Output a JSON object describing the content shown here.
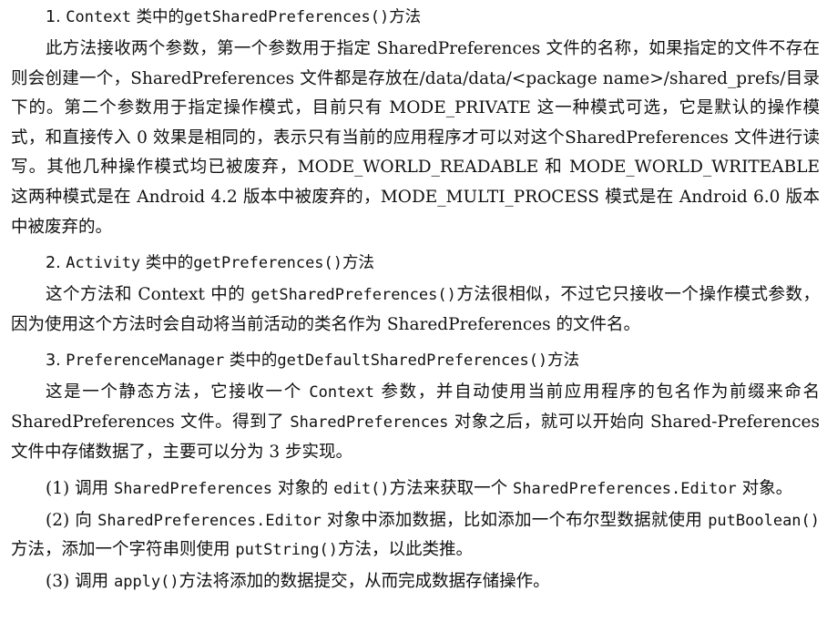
{
  "sections": [
    {
      "number": "1.",
      "heading_code": "Context",
      "heading_mid": "类中的",
      "heading_code2": "getSharedPreferences()",
      "heading_tail": "方法",
      "body": "此方法接收两个参数，第一个参数用于指定 SharedPreferences 文件的名称，如果指定的文件不存在则会创建一个，SharedPreferences 文件都是存放在/data/data/<package name>/shared_prefs/目录下的。第二个参数用于指定操作模式，目前只有 MODE_PRIVATE 这一种模式可选，它是默认的操作模式，和直接传入 0 效果是相同的，表示只有当前的应用程序才可以对这个SharedPreferences 文件进行读写。其他几种操作模式均已被废弃，MODE_WORLD_READABLE 和 MODE_WORLD_WRITEABLE 这两种模式是在 Android 4.2 版本中被废弃的，MODE_MULTI_PROCESS 模式是在 Android 6.0 版本中被废弃的。"
    },
    {
      "number": "2.",
      "heading_code": "Activity",
      "heading_mid": "类中的",
      "heading_code2": "getPreferences()",
      "heading_tail": "方法",
      "body_1": "这个方法和 Context 中的 ",
      "body_code": "getSharedPreferences()",
      "body_2": "方法很相似，不过它只接收一个操作模式参数，因为使用这个方法时会自动将当前活动的类名作为 SharedPreferences 的文件名。"
    },
    {
      "number": "3.",
      "heading_code": "PreferenceManager",
      "heading_mid": "类中的",
      "heading_code2": "getDefaultSharedPreferences()",
      "heading_tail": "方法",
      "body_1": "这是一个静态方法，它接收一个 ",
      "body_code": "Context",
      "body_2": " 参数，并自动使用当前应用程序的包名作为前缀来命名 SharedPreferences 文件。得到了 ",
      "body_code2": "SharedPreferences",
      "body_3": " 对象之后，就可以开始向 Shared-Preferences 文件中存储数据了，主要可以分为 3 步实现。"
    }
  ],
  "steps": [
    {
      "label": "(1) 调用 ",
      "code": "SharedPreferences",
      "text_1": " 对象的 ",
      "code2": "edit()",
      "text_2": "方法来获取一个 ",
      "code3": "SharedPreferences.Editor",
      "text_3": " 对象。"
    },
    {
      "label": "(2) 向 ",
      "code": "SharedPreferences.Editor",
      "text_1": " 对象中添加数据，比如添加一个布尔型数据就使用 ",
      "code2": "putBoolean()",
      "text_2": "方法，添加一个字符串则使用 ",
      "code3": "putString()",
      "text_3": "方法，以此类推。"
    },
    {
      "label": "(3) 调用 ",
      "code": "apply()",
      "text_1": "方法将添加的数据提交，从而完成数据存储操作。"
    }
  ]
}
